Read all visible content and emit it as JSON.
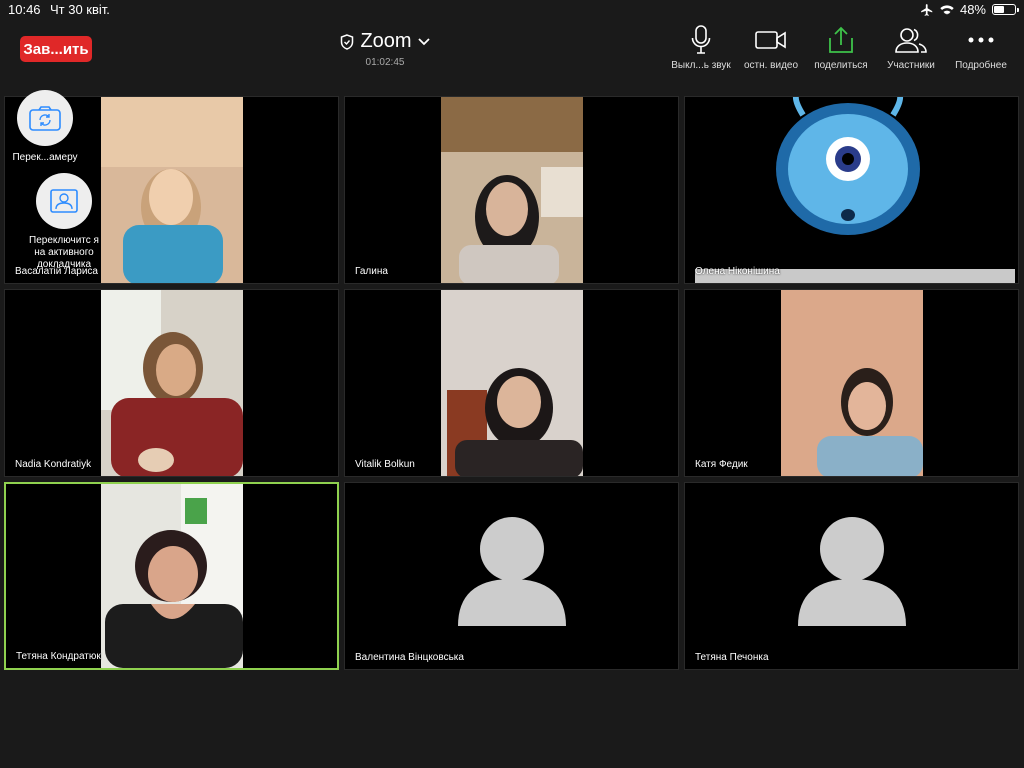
{
  "status_bar": {
    "time": "10:46",
    "date": "Чт 30 квіт.",
    "battery": "48%",
    "battery_level": 0.48
  },
  "header": {
    "end_button": "Зав...ить",
    "title": "Zoom",
    "timer": "01:02:45"
  },
  "toolbar": [
    {
      "label": "Выкл...ь звук",
      "icon": "microphone-icon"
    },
    {
      "label": "остн. видео",
      "icon": "video-camera-icon"
    },
    {
      "label": "поделиться",
      "icon": "share-icon"
    },
    {
      "label": "Участники",
      "icon": "participants-icon"
    },
    {
      "label": "Подробнее",
      "icon": "more-icon"
    }
  ],
  "floating": {
    "switch_camera": "Перек...амеру",
    "switch_speaker": "Переключитс я на активного докладчика"
  },
  "participants": [
    {
      "name": "Васалатій Лариса",
      "video": true
    },
    {
      "name": "Галина",
      "video": true
    },
    {
      "name": "Олена Ніконішина",
      "video": true
    },
    {
      "name": "Nadia Kondratiyk",
      "video": true
    },
    {
      "name": "Vitalik Bolkun",
      "video": true
    },
    {
      "name": "Катя Федик",
      "video": true
    },
    {
      "name": "Тетяна Кондратюк",
      "video": true,
      "active": true
    },
    {
      "name": "Валентина Вінцковська",
      "video": false
    },
    {
      "name": "Тетяна Печонка",
      "video": false
    }
  ],
  "colors": {
    "end_button": "#e02828",
    "active_speaker_border": "#8fd14f",
    "share_icon": "#3ec24a"
  }
}
